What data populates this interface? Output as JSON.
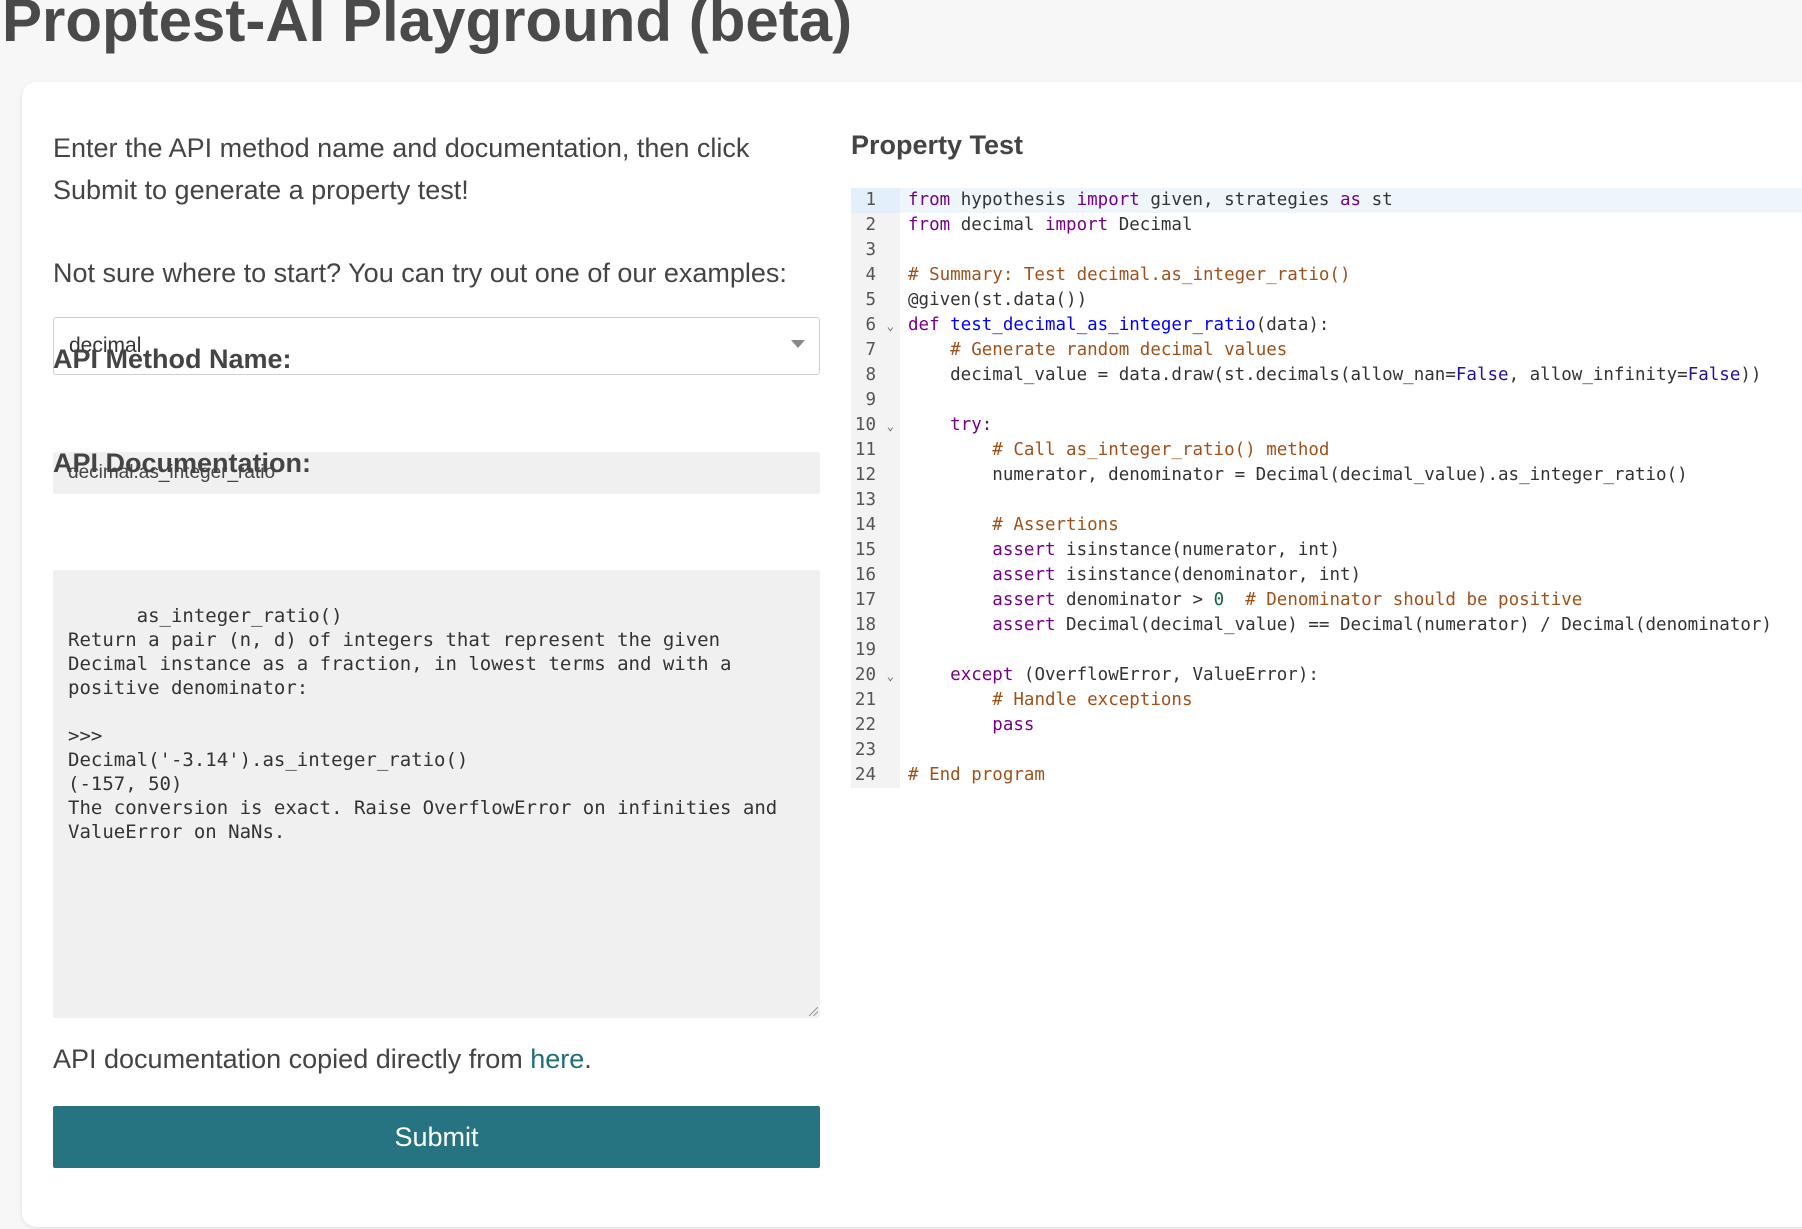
{
  "page": {
    "title": "Proptest-AI Playground (beta)"
  },
  "left": {
    "intro": "Enter the API method name and documentation, then click Submit to generate a property test!",
    "examples_prompt": "Not sure where to start? You can try out one of our examples:",
    "example_select_value": "decimal",
    "method_label": "API Method Name:",
    "method_value": "decimal.as_integer_ratio",
    "doc_label": "API Documentation:",
    "doc_value": "as_integer_ratio()\nReturn a pair (n, d) of integers that represent the given Decimal instance as a fraction, in lowest terms and with a positive denominator:\n\n>>>\nDecimal('-3.14').as_integer_ratio()\n(-157, 50)\nThe conversion is exact. Raise OverflowError on infinities and ValueError on NaNs.",
    "source_prefix": "API documentation copied directly from ",
    "source_link": "here",
    "source_suffix": ".",
    "submit_label": "Submit"
  },
  "right": {
    "title": "Property Test",
    "code_lines": [
      "from hypothesis import given, strategies as st",
      "from decimal import Decimal",
      "",
      "# Summary: Test decimal.as_integer_ratio()",
      "@given(st.data())",
      "def test_decimal_as_integer_ratio(data):",
      "    # Generate random decimal values",
      "    decimal_value = data.draw(st.decimals(allow_nan=False, allow_infinity=False))",
      "",
      "    try:",
      "        # Call as_integer_ratio() method",
      "        numerator, denominator = Decimal(decimal_value).as_integer_ratio()",
      "",
      "        # Assertions",
      "        assert isinstance(numerator, int)",
      "        assert isinstance(denominator, int)",
      "        assert denominator > 0  # Denominator should be positive",
      "        assert Decimal(decimal_value) == Decimal(numerator) / Decimal(denominator)",
      "",
      "    except (OverflowError, ValueError):",
      "        # Handle exceptions",
      "        pass",
      "",
      "# End program"
    ],
    "fold_lines": [
      6,
      10,
      20
    ],
    "active_line": 1
  },
  "colors": {
    "submit_bg": "#267382",
    "link": "#1e6f78",
    "keyword": "#770088",
    "function_def": "#0000ff",
    "comment": "#a0511a",
    "boolean": "#221199",
    "number": "#116644"
  }
}
